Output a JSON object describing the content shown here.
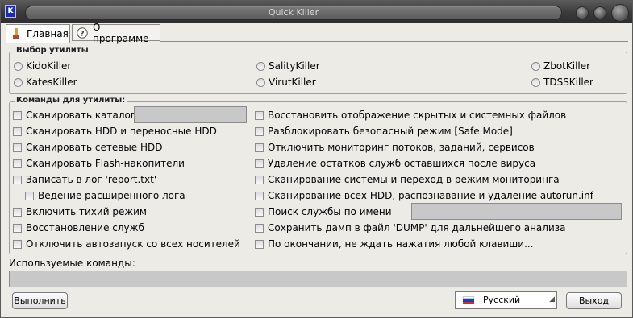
{
  "window": {
    "title": "Quick Killer",
    "icon_letter": "K"
  },
  "tabs": [
    {
      "label": "Главная",
      "icon": "paint-brush-icon"
    },
    {
      "label": "О программе",
      "icon": "help-icon",
      "glyph": "?"
    }
  ],
  "utility_group": {
    "label": "Выбор утилиты",
    "options": [
      "KidoKiller",
      "SalityKiller",
      "ZbotKiller",
      "KatesKiller",
      "VirutKiller",
      "TDSSKiller"
    ]
  },
  "commands_group": {
    "label": "Команды для утилиты:",
    "left": [
      "Сканировать каталог",
      "Сканировать HDD и переносные HDD",
      "Сканировать сетевые HDD",
      "Сканировать Flash-накопители",
      "Записать в лог 'report.txt'",
      "Ведение расширенного лога",
      "Включить тихий режим",
      "Восстановление служб",
      "Отключить автозапуск со всех носителей"
    ],
    "right": [
      "Восстановить отображение скрытых и системных файлов",
      "Разблокировать безопасный режим [Safe Mode]",
      "Отключить мониторинг потоков, заданий, сервисов",
      "Удаление остатков служб оставшихся после вируса",
      "Сканирование системы и переход в режим мониторинга",
      "Сканирование всех HDD, распознавание и удаление autorun.inf",
      "Поиск службы по имени",
      "Сохранить дамп в файл 'DUMP' для дальнейшего анализа",
      "По окончании, не ждать нажатия любой клавиши..."
    ]
  },
  "used_commands": {
    "label": "Используемые команды:",
    "value": ""
  },
  "footer": {
    "run": "Выполнить",
    "language": "Русский",
    "exit": "Выход"
  },
  "colors": {
    "titlebar": "#3c3c3c",
    "field": "#c8c8c8",
    "background": "#ecebe6"
  }
}
